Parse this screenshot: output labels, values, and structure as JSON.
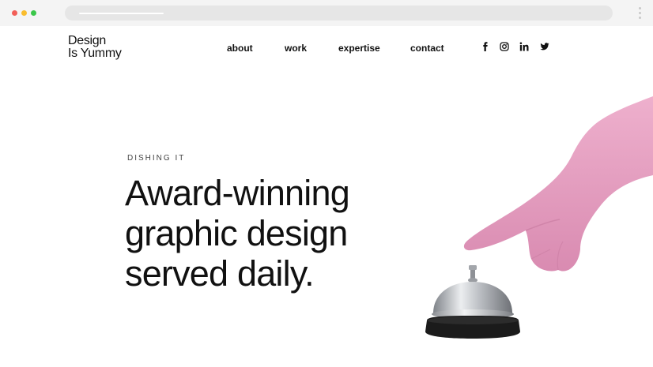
{
  "browser": {
    "address_text": ""
  },
  "header": {
    "logo_line1": "Design",
    "logo_line2": "Is Yummy",
    "nav": [
      {
        "label": "about"
      },
      {
        "label": "work"
      },
      {
        "label": "expertise"
      },
      {
        "label": "contact"
      }
    ],
    "social": [
      {
        "icon": "facebook-icon"
      },
      {
        "icon": "instagram-icon"
      },
      {
        "icon": "linkedin-icon"
      },
      {
        "icon": "twitter-icon"
      }
    ]
  },
  "hero": {
    "eyebrow": "DISHING IT",
    "headline": [
      "Award-winning",
      "graphic design",
      "served daily."
    ],
    "image": "pink-glove-finger-pressing-service-bell"
  },
  "colors": {
    "glove_pink": "#e59cc0",
    "bell_silver": "#c9cbcf",
    "bell_base": "#1b1b1b"
  }
}
